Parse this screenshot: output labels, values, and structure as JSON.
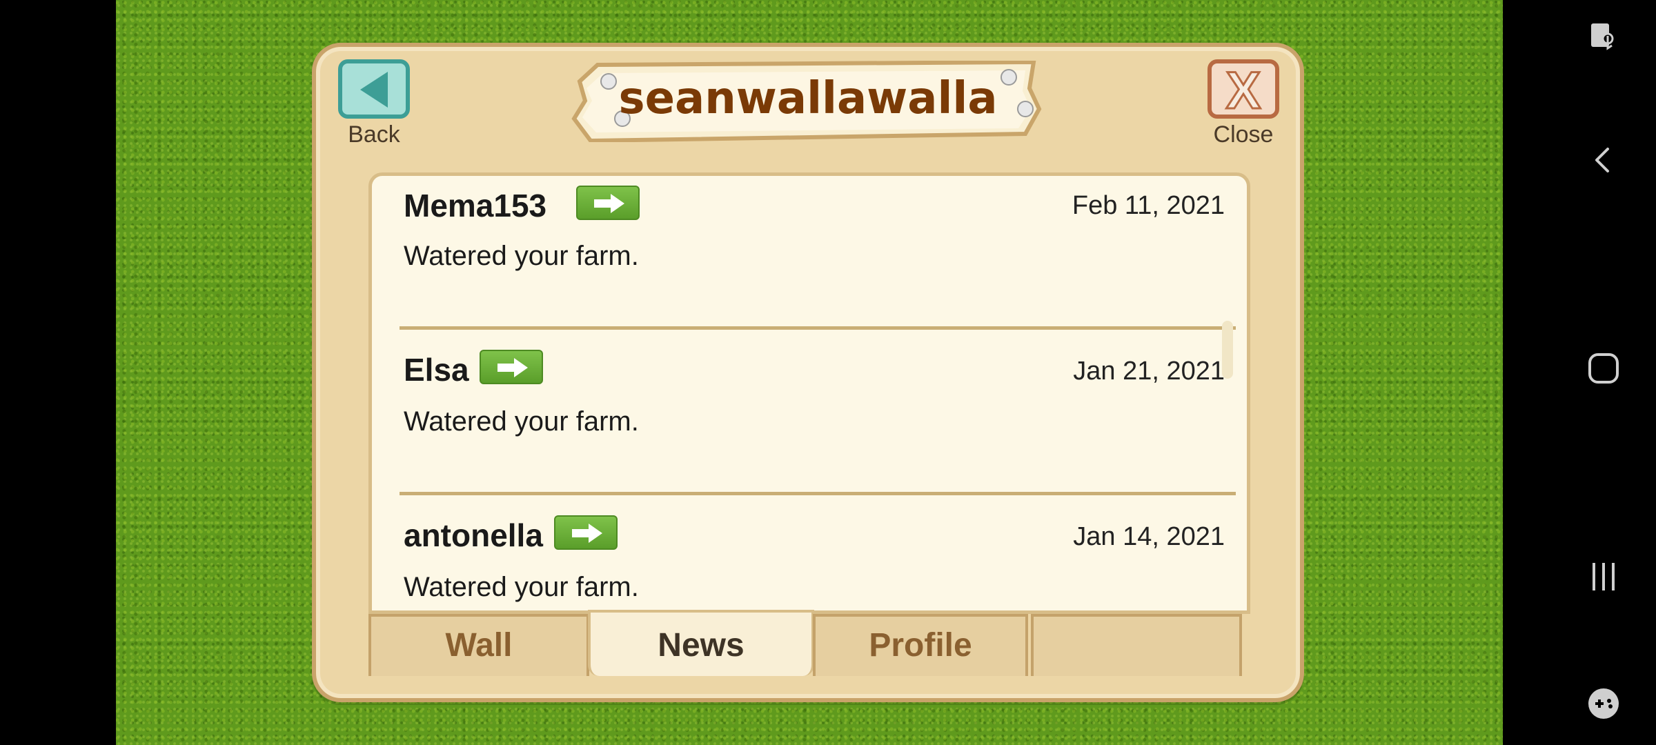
{
  "header": {
    "title": "seanwallawalla",
    "back_label": "Back",
    "close_label": "Close"
  },
  "news": {
    "items": [
      {
        "name": "Mema153",
        "date": "Feb 11, 2021",
        "message": "Watered your farm."
      },
      {
        "name": "Elsa",
        "date": "Jan 21, 2021",
        "message": "Watered your farm."
      },
      {
        "name": "antonella",
        "date": "Jan 14, 2021",
        "message": "Watered your farm."
      }
    ]
  },
  "tabs": {
    "items": [
      {
        "label": "Wall"
      },
      {
        "label": "News"
      },
      {
        "label": "Profile"
      },
      {
        "label": ""
      }
    ],
    "active": "News"
  },
  "system_nav": {
    "icons": [
      "screen-touch-icon",
      "back-arrow-icon",
      "home-icon",
      "recents-icon",
      "game-controller-icon"
    ]
  },
  "colors": {
    "grass": "#5f9a1d",
    "panel": "#ecd6a6",
    "title_text": "#7a3a06",
    "go_button": "#6aae34",
    "back_button": "#3d9e96",
    "close_button": "#b86a42"
  }
}
